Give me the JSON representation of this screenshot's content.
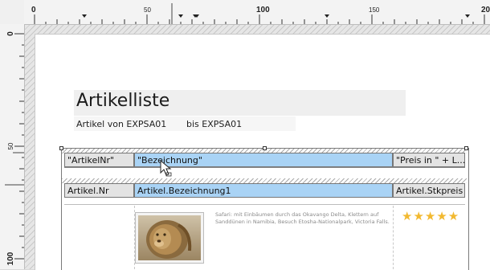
{
  "ruler": {
    "h_labels": [
      "0",
      "50",
      "100",
      "150",
      "200"
    ],
    "v_labels": [
      "0",
      "50",
      "100"
    ]
  },
  "report": {
    "title": "Artikelliste",
    "subtitle_from": "Artikel von EXPSA01",
    "subtitle_to": "bis EXPSA01"
  },
  "table": {
    "header_row": [
      "\"ArtikelNr\"",
      "\"Bezeichnung\"",
      "\"Preis in \" + L..."
    ],
    "field_row": [
      "Artikel.Nr",
      "Artikel.Bezeichnung1",
      "Artikel.Stkpreis"
    ]
  },
  "detail": {
    "image_icon": "lion-photo",
    "description": "Safari: mit Einbäumen durch das Okavango Delta, Klettern auf Sanddünen in Namibia, Besuch Etosha-Nationalpark, Victoria Falls.",
    "rating": "★★★★★"
  },
  "colors": {
    "field_blue": "#a9d3f5",
    "star_gold": "#f2b930"
  }
}
